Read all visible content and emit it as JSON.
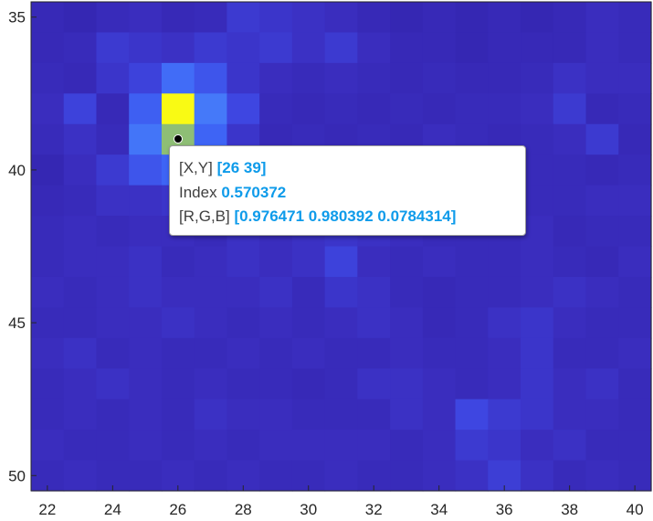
{
  "chart_data": {
    "type": "heatmap",
    "colormap": "parula",
    "xlim": [
      21.5,
      40.5
    ],
    "ylim": [
      34.5,
      50.5
    ],
    "y_direction": "reverse",
    "x_ticks": [
      22,
      24,
      26,
      28,
      30,
      32,
      34,
      36,
      38,
      40
    ],
    "y_ticks": [
      35,
      40,
      45,
      50
    ],
    "x_tick_labels": [
      "22",
      "24",
      "26",
      "28",
      "30",
      "32",
      "34",
      "36",
      "38",
      "40"
    ],
    "y_tick_labels": [
      "35",
      "40",
      "45",
      "50"
    ],
    "grid": false,
    "x_start": 22,
    "y_start": 35,
    "values": [
      [
        0.06,
        0.05,
        0.07,
        0.08,
        0.06,
        0.07,
        0.11,
        0.1,
        0.09,
        0.08,
        0.06,
        0.05,
        0.06,
        0.05,
        0.06,
        0.05,
        0.06,
        0.08,
        0.07
      ],
      [
        0.06,
        0.07,
        0.11,
        0.1,
        0.09,
        0.11,
        0.1,
        0.11,
        0.09,
        0.11,
        0.08,
        0.06,
        0.06,
        0.05,
        0.06,
        0.06,
        0.06,
        0.08,
        0.07
      ],
      [
        0.07,
        0.06,
        0.1,
        0.13,
        0.22,
        0.17,
        0.1,
        0.08,
        0.07,
        0.08,
        0.07,
        0.06,
        0.07,
        0.06,
        0.06,
        0.07,
        0.09,
        0.08,
        0.08
      ],
      [
        0.08,
        0.13,
        0.06,
        0.19,
        1.0,
        0.25,
        0.14,
        0.07,
        0.06,
        0.07,
        0.06,
        0.07,
        0.06,
        0.07,
        0.07,
        0.08,
        0.11,
        0.06,
        0.07
      ],
      [
        0.07,
        0.09,
        0.07,
        0.24,
        0.57,
        0.2,
        0.1,
        0.06,
        0.07,
        0.06,
        0.07,
        0.06,
        0.08,
        0.07,
        0.06,
        0.07,
        0.08,
        0.11,
        0.06
      ],
      [
        0.05,
        0.08,
        0.11,
        0.17,
        0.2,
        0.11,
        0.09,
        0.08,
        0.07,
        0.06,
        0.07,
        0.07,
        0.06,
        0.07,
        0.08,
        0.07,
        0.07,
        0.06,
        0.07
      ],
      [
        0.06,
        0.07,
        0.09,
        0.09,
        0.1,
        0.09,
        0.09,
        0.1,
        0.08,
        0.1,
        0.08,
        0.07,
        0.07,
        0.06,
        0.07,
        0.07,
        0.07,
        0.08,
        0.08
      ],
      [
        0.07,
        0.08,
        0.07,
        0.08,
        0.08,
        0.07,
        0.09,
        0.08,
        0.09,
        0.1,
        0.09,
        0.08,
        0.07,
        0.07,
        0.07,
        0.08,
        0.06,
        0.07,
        0.07
      ],
      [
        0.07,
        0.08,
        0.08,
        0.09,
        0.07,
        0.08,
        0.09,
        0.08,
        0.09,
        0.13,
        0.08,
        0.07,
        0.08,
        0.07,
        0.07,
        0.08,
        0.07,
        0.06,
        0.08
      ],
      [
        0.08,
        0.07,
        0.08,
        0.09,
        0.08,
        0.08,
        0.08,
        0.09,
        0.07,
        0.1,
        0.09,
        0.07,
        0.06,
        0.07,
        0.07,
        0.08,
        0.09,
        0.08,
        0.07
      ],
      [
        0.07,
        0.07,
        0.08,
        0.08,
        0.09,
        0.08,
        0.07,
        0.08,
        0.07,
        0.08,
        0.09,
        0.08,
        0.06,
        0.07,
        0.09,
        0.1,
        0.08,
        0.07,
        0.07
      ],
      [
        0.08,
        0.09,
        0.07,
        0.08,
        0.07,
        0.07,
        0.08,
        0.07,
        0.08,
        0.07,
        0.07,
        0.08,
        0.07,
        0.07,
        0.08,
        0.1,
        0.07,
        0.07,
        0.08
      ],
      [
        0.07,
        0.08,
        0.09,
        0.08,
        0.07,
        0.08,
        0.07,
        0.07,
        0.06,
        0.07,
        0.09,
        0.09,
        0.08,
        0.07,
        0.08,
        0.1,
        0.08,
        0.09,
        0.07
      ],
      [
        0.07,
        0.08,
        0.07,
        0.08,
        0.07,
        0.09,
        0.08,
        0.08,
        0.07,
        0.07,
        0.07,
        0.09,
        0.08,
        0.14,
        0.11,
        0.1,
        0.08,
        0.08,
        0.07
      ],
      [
        0.08,
        0.07,
        0.07,
        0.08,
        0.07,
        0.08,
        0.07,
        0.08,
        0.08,
        0.08,
        0.08,
        0.07,
        0.08,
        0.11,
        0.1,
        0.08,
        0.09,
        0.07,
        0.07
      ],
      [
        0.07,
        0.08,
        0.07,
        0.07,
        0.08,
        0.07,
        0.08,
        0.07,
        0.07,
        0.08,
        0.07,
        0.07,
        0.08,
        0.09,
        0.12,
        0.09,
        0.07,
        0.08,
        0.07
      ]
    ],
    "datatip": {
      "x": 26,
      "y": 39,
      "xy_label": "[X,Y]",
      "xy_value": "[26 39]",
      "index_label": "Index",
      "index_value": "0.570372",
      "rgb_label": "[R,G,B]",
      "rgb_value": "[0.976471 0.980392 0.0784314]"
    }
  }
}
